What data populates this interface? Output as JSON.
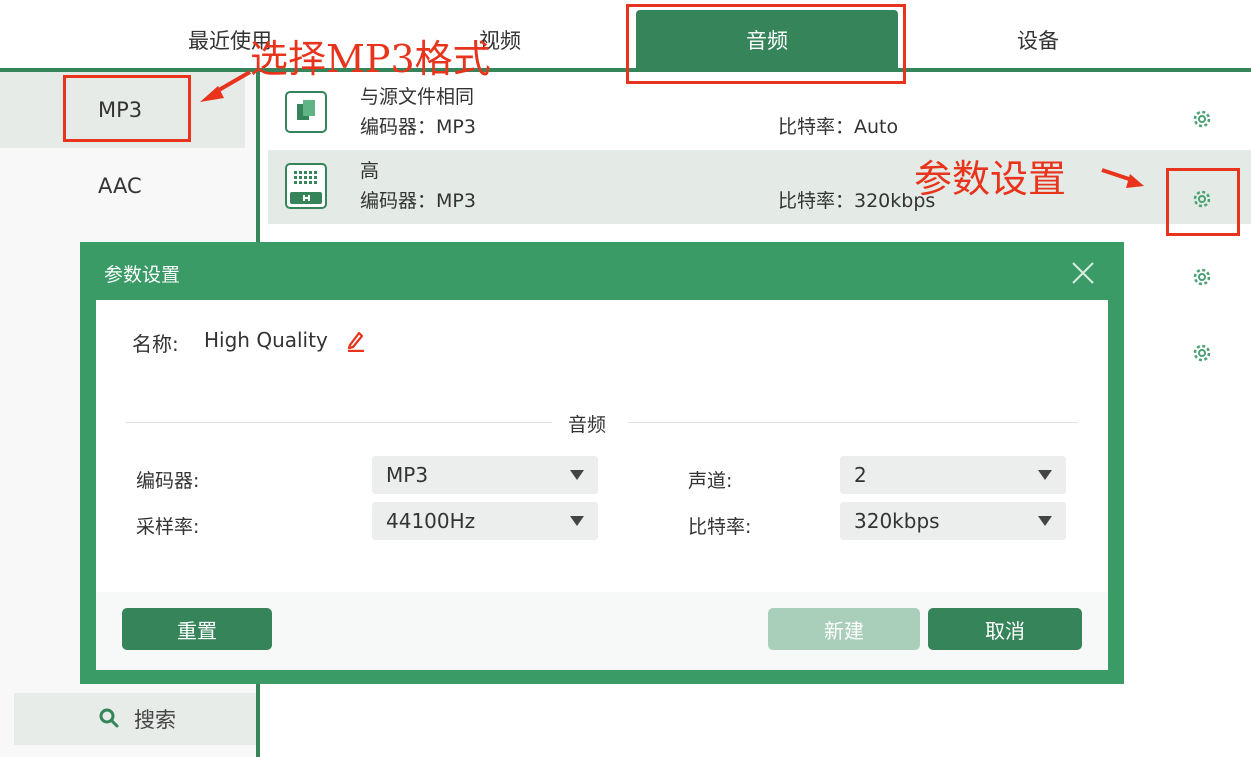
{
  "tabs": [
    {
      "label": "最近使用"
    },
    {
      "label": "视频"
    },
    {
      "label": "音频",
      "active": true
    },
    {
      "label": "设备"
    }
  ],
  "sidebar": {
    "items": [
      {
        "label": "MP3",
        "selected": true
      },
      {
        "label": "AAC"
      }
    ],
    "search_label": "搜索"
  },
  "presets": [
    {
      "name": "与源文件相同",
      "encoder": "编码器：MP3",
      "bitrate": "比特率：Auto"
    },
    {
      "name": "高",
      "encoder": "编码器：MP3",
      "bitrate": "比特率：320kbps",
      "highlighted": true
    }
  ],
  "dialog": {
    "title": "参数设置",
    "name_label": "名称:",
    "name_value": "High Quality",
    "section_title": "音频",
    "fields": {
      "encoder_label": "编码器:",
      "encoder_value": "MP3",
      "samplerate_label": "采样率:",
      "samplerate_value": "44100Hz",
      "channel_label": "声道:",
      "channel_value": "2",
      "bitrate_label": "比特率:",
      "bitrate_value": "320kbps"
    },
    "buttons": {
      "reset": "重置",
      "new": "新建",
      "cancel": "取消"
    }
  },
  "annotations": {
    "select_mp3": "选择MP3格式",
    "param_settings": "参数设置"
  },
  "colors": {
    "accent": "#35845a",
    "dialog": "#3a9b67",
    "annotation": "#e8341c"
  }
}
